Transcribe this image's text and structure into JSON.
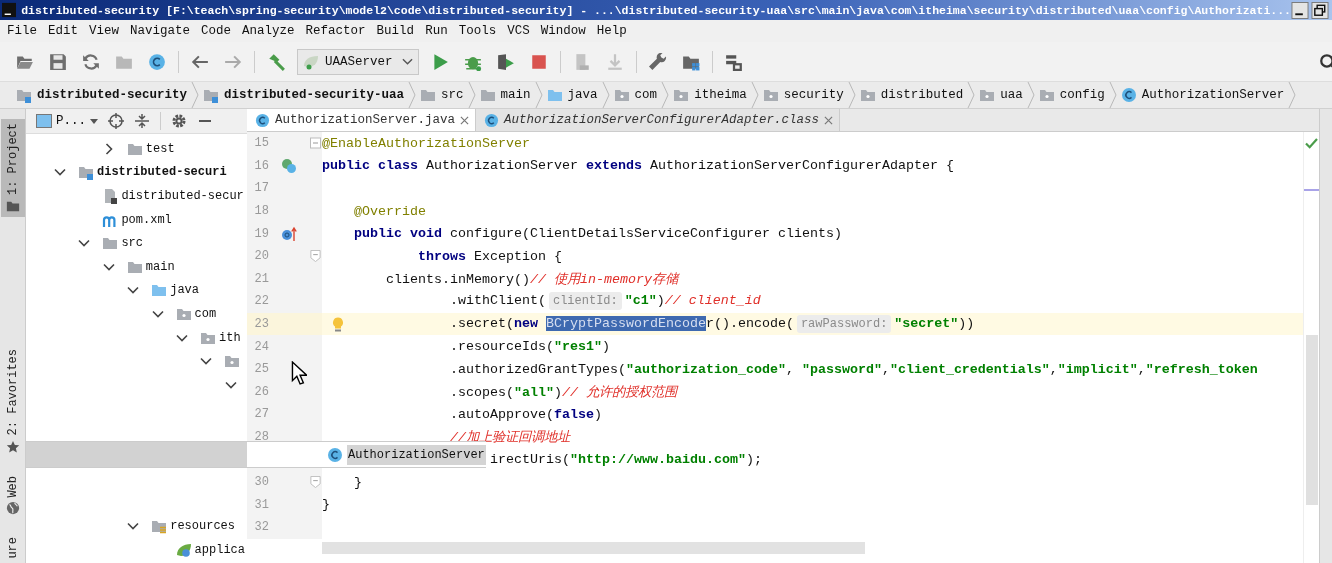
{
  "window": {
    "title": "distributed-security [F:\\teach\\spring-security\\model2\\code\\distributed-security] - ...\\distributed-security-uaa\\src\\main\\java\\com\\itheima\\security\\distributed\\uaa\\config\\Authorizati..."
  },
  "menu": [
    "File",
    "Edit",
    "View",
    "Navigate",
    "Code",
    "Analyze",
    "Refactor",
    "Build",
    "Run",
    "Tools",
    "VCS",
    "Window",
    "Help"
  ],
  "toolbar": {
    "run_configuration": "UAAServer"
  },
  "nav_bar": [
    {
      "label": "distributed-security",
      "kind": "module"
    },
    {
      "label": "distributed-security-uaa",
      "kind": "module"
    },
    {
      "label": "src",
      "kind": "folder"
    },
    {
      "label": "main",
      "kind": "folder"
    },
    {
      "label": "java",
      "kind": "source"
    },
    {
      "label": "com",
      "kind": "package"
    },
    {
      "label": "itheima",
      "kind": "package"
    },
    {
      "label": "security",
      "kind": "package"
    },
    {
      "label": "distributed",
      "kind": "package"
    },
    {
      "label": "uaa",
      "kind": "package"
    },
    {
      "label": "config",
      "kind": "package"
    },
    {
      "label": "AuthorizationServer",
      "kind": "class"
    }
  ],
  "tool_windows_left": [
    {
      "label": "1: Project",
      "kind": "folder",
      "selected": true
    },
    {
      "label": "2: Favorites",
      "kind": "star",
      "selected": false
    },
    {
      "label": "Web",
      "kind": "globe",
      "selected": false
    },
    {
      "label": "ure",
      "selected": false
    }
  ],
  "project_panel": {
    "view": "P...",
    "tree": [
      {
        "children": [
          {
            "children": [
              {
                "label": "test",
                "kind": "folder",
                "expanded": false
              }
            ]
          }
        ]
      },
      {
        "label": "distributed-securi",
        "kind": "module",
        "expanded": true,
        "children": [
          {
            "label": "distributed-secur",
            "kind": "iml"
          },
          {
            "label": "pom.xml",
            "kind": "maven"
          },
          {
            "label": "src",
            "kind": "folder",
            "expanded": true,
            "children": [
              {
                "label": "main",
                "kind": "folder",
                "expanded": true,
                "children": [
                  {
                    "label": "java",
                    "kind": "source",
                    "expanded": true,
                    "children": [
                      {
                        "label": "com",
                        "kind": "package",
                        "expanded": true,
                        "children": [
                          {
                            "label": "ith",
                            "kind": "package",
                            "expanded": true,
                            "children": [
                              {
                                "kind": "package",
                                "expanded": true,
                                "children": [
                                  {
                                    "expanded": true
                                  }
                                ]
                              }
                            ]
                          }
                        ]
                      }
                    ]
                  },
                  {
                    "label": "resources",
                    "kind": "resources",
                    "expanded": true,
                    "children": [
                      {
                        "label": "applica",
                        "kind": "spring"
                      }
                    ]
                  }
                ]
              }
            ]
          }
        ]
      }
    ]
  },
  "editor": {
    "tabs": [
      {
        "label": "AuthorizationServer.java",
        "kind": "class",
        "selected": true
      },
      {
        "label": "AuthorizationServerConfigurerAdapter.class",
        "kind": "compiled",
        "selected": false
      }
    ],
    "lines": [
      {
        "number": "15",
        "current": false,
        "fold": {
          "kind": "start"
        },
        "tokens": [
          {
            "kind": "annotation",
            "text": "@EnableAuthorizationServer"
          }
        ]
      },
      {
        "number": "16",
        "current": false,
        "gutter": {
          "kind": "implemented"
        },
        "tokens": [
          {
            "kind": "keyword",
            "text": "public class"
          },
          {
            "kind": "plain",
            "text": " AuthorizationServer "
          },
          {
            "kind": "keyword",
            "text": "extends"
          },
          {
            "kind": "plain",
            "text": " AuthorizationServerConfigurerAdapter {"
          }
        ]
      },
      {
        "number": "17",
        "current": false
      },
      {
        "number": "18",
        "current": false,
        "tokens": [
          {
            "kind": "annotation",
            "text": "    @Override"
          }
        ]
      },
      {
        "number": "19",
        "current": false,
        "gutter": {
          "kind": "override"
        },
        "tokens": [
          {
            "kind": "keyword",
            "text": "    public void"
          },
          {
            "kind": "plain",
            "text": " configure(ClientDetailsServiceConfigurer clients)"
          }
        ]
      },
      {
        "number": "20",
        "current": false,
        "fold": {
          "kind": "end"
        },
        "tokens": [
          {
            "kind": "keyword",
            "text": "            throws"
          },
          {
            "kind": "plain",
            "text": " Exception {"
          }
        ]
      },
      {
        "number": "21",
        "current": false,
        "tokens": [
          {
            "kind": "plain",
            "text": "        clients.inMemory()"
          },
          {
            "kind": "comment",
            "text": "// 使用in-memory存储"
          }
        ]
      },
      {
        "number": "22",
        "current": false,
        "tokens": [
          {
            "kind": "plain",
            "text": "                .withClient("
          },
          {
            "kind": "hint",
            "text": "clientId:"
          },
          {
            "kind": "string",
            "text": "\"c1\""
          },
          {
            "kind": "plain",
            "text": ")"
          },
          {
            "kind": "comment",
            "text": "// client_id"
          }
        ]
      },
      {
        "number": "23",
        "current": true,
        "gutter": {
          "kind": "bulb"
        },
        "tokens": [
          {
            "kind": "plain",
            "text": "                .secret("
          },
          {
            "kind": "keyword",
            "text": "new "
          },
          {
            "kind": "selection",
            "text": "BCryptPasswordEncode"
          },
          {
            "kind": "plain",
            "text": "r().encode("
          },
          {
            "kind": "hint",
            "text": "rawPassword:"
          },
          {
            "kind": "string",
            "text": "\"secret\""
          },
          {
            "kind": "plain",
            "text": "))"
          }
        ]
      },
      {
        "number": "24",
        "current": false,
        "tokens": [
          {
            "kind": "plain",
            "text": "                .resourceIds("
          },
          {
            "kind": "string",
            "text": "\"res1\""
          },
          {
            "kind": "plain",
            "text": ")"
          }
        ]
      },
      {
        "number": "25",
        "current": false,
        "tokens": [
          {
            "kind": "plain",
            "text": "                .authorizedGrantTypes("
          },
          {
            "kind": "string",
            "text": "\"authorization_code\""
          },
          {
            "kind": "plain",
            "text": ", "
          },
          {
            "kind": "string",
            "text": "\"password\""
          },
          {
            "kind": "plain",
            "text": ","
          },
          {
            "kind": "string",
            "text": "\"client_credentials\""
          },
          {
            "kind": "plain",
            "text": ","
          },
          {
            "kind": "string",
            "text": "\"implicit\""
          },
          {
            "kind": "plain",
            "text": ","
          },
          {
            "kind": "string",
            "text": "\"refresh_token"
          }
        ]
      },
      {
        "number": "26",
        "current": false,
        "tokens": [
          {
            "kind": "plain",
            "text": "                .scopes("
          },
          {
            "kind": "string",
            "text": "\"all\""
          },
          {
            "kind": "plain",
            "text": ")"
          },
          {
            "kind": "comment",
            "text": "// 允许的授权范围"
          }
        ]
      },
      {
        "number": "27",
        "current": false,
        "tokens": [
          {
            "kind": "plain",
            "text": "                .autoApprove("
          },
          {
            "kind": "keyword",
            "text": "false"
          },
          {
            "kind": "plain",
            "text": ")"
          }
        ]
      },
      {
        "number": "28",
        "current": false,
        "tokens": [
          {
            "kind": "comment",
            "text": "                //加上验证回调地址"
          }
        ]
      },
      {
        "current": false,
        "tokens": [
          {
            "kind": "plain",
            "text": "                     irectUris("
          },
          {
            "kind": "string",
            "text": "\"http://www.baidu.com\""
          },
          {
            "kind": "plain",
            "text": ");"
          }
        ]
      },
      {
        "number": "30",
        "current": false,
        "fold": {
          "kind": "end"
        },
        "tokens": [
          {
            "kind": "plain",
            "text": "    }"
          }
        ]
      },
      {
        "number": "31",
        "current": false,
        "tokens": [
          {
            "kind": "plain",
            "text": "}"
          }
        ]
      },
      {
        "number": "32",
        "current": false
      }
    ]
  },
  "drag_popup": {
    "label": "AuthorizationServer",
    "kind": "class"
  }
}
